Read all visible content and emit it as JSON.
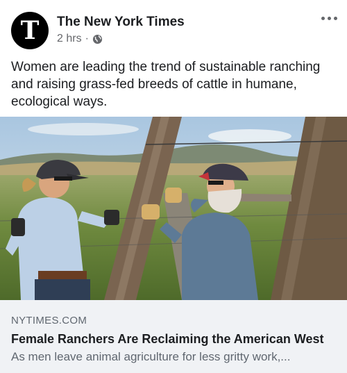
{
  "post": {
    "page_name": "The New York Times",
    "avatar_glyph": "T",
    "timestamp": "2 hrs",
    "separator": "·",
    "privacy_icon": "globe-icon",
    "more_icon": "more-options-icon",
    "text": "Women are leading the trend of sustainable ranching and raising grass-fed breeds of cattle in humane, ecological ways."
  },
  "photo": {
    "subject": "two-women-ranchers-mending-fence"
  },
  "link": {
    "domain": "NYTIMES.COM",
    "title": "Female Ranchers Are Reclaiming the American West",
    "description": "As men leave animal agriculture for less gritty work,..."
  },
  "colors": {
    "secondary_text": "#65676b",
    "link_background": "#f0f2f5",
    "brand_avatar": "#000000"
  }
}
